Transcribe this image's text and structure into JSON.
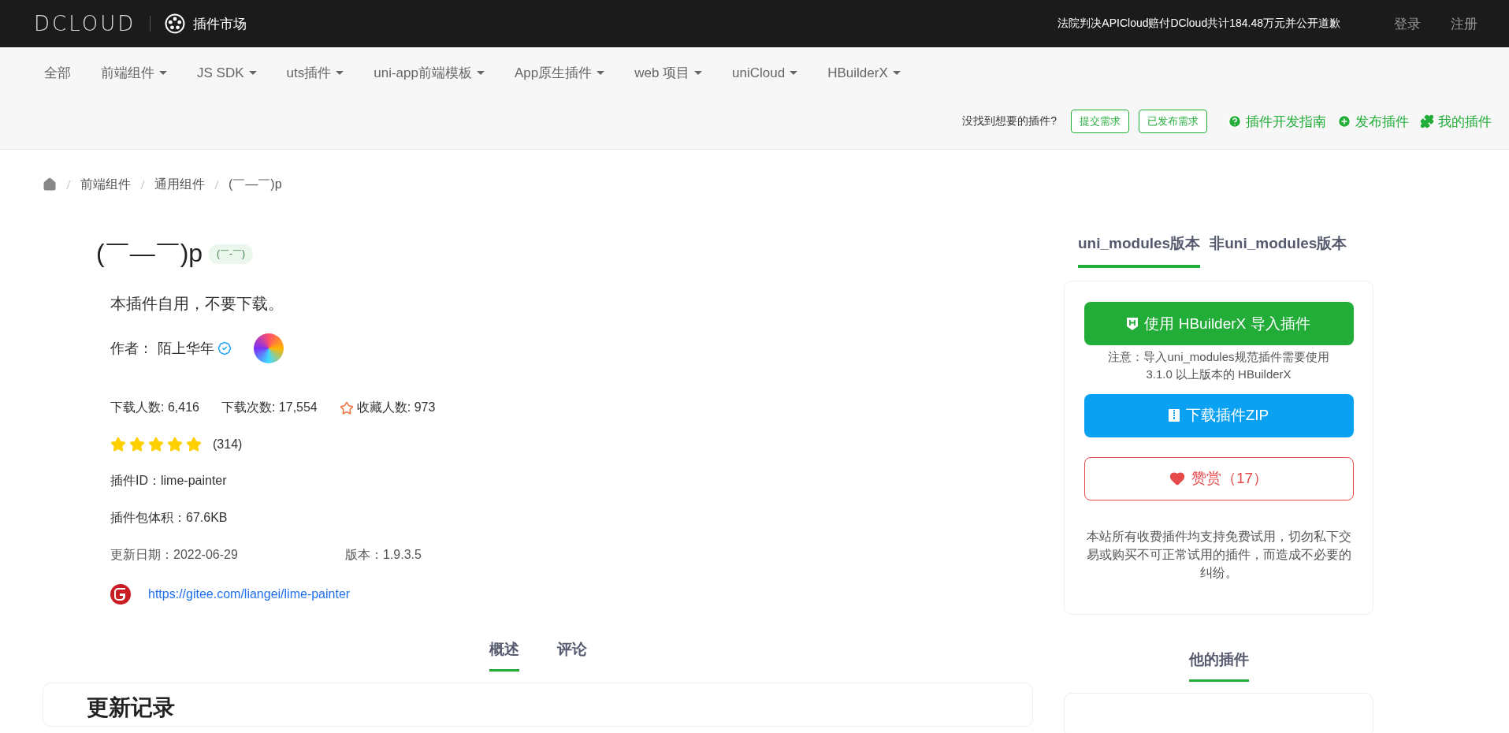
{
  "header": {
    "logo": "DCLOUD",
    "market": "插件市场",
    "notice": "法院判决APICloud赔付DCloud共计184.48万元并公开道歉",
    "links": [
      "登录",
      "注册"
    ]
  },
  "nav": {
    "items": [
      {
        "label": "全部",
        "dropdown": false
      },
      {
        "label": "前端组件",
        "dropdown": true
      },
      {
        "label": "JS SDK",
        "dropdown": true
      },
      {
        "label": "uts插件",
        "dropdown": true
      },
      {
        "label": "uni-app前端模板",
        "dropdown": true
      },
      {
        "label": "App原生插件",
        "dropdown": true
      },
      {
        "label": "web 项目",
        "dropdown": true
      },
      {
        "label": "uniCloud",
        "dropdown": true
      },
      {
        "label": "HBuilderX",
        "dropdown": true
      }
    ],
    "prompt": "没找到想要的插件?",
    "outline_buttons": [
      "提交需求",
      "已发布需求"
    ],
    "actions": [
      {
        "kind": "help",
        "label": "插件开发指南"
      },
      {
        "kind": "publish",
        "label": "发布插件"
      },
      {
        "kind": "puzzle",
        "label": "我的插件"
      }
    ]
  },
  "breadcrumb": [
    "前端组件",
    "通用组件",
    "(￣—￣)p"
  ],
  "plugin": {
    "title": "(￣—￣)p",
    "badge": "(￣-￣)",
    "description": "本插件自用，不要下载。",
    "author_label": "作者：",
    "author": "陌上华年",
    "verified": true,
    "stats": [
      {
        "kind": "plain",
        "text": "下载人数: 6,416"
      },
      {
        "kind": "plain",
        "text": "下载次数: 17,554"
      },
      {
        "kind": "favorite",
        "text": "收藏人数: 973"
      }
    ],
    "stars": 5,
    "rating_count": "(314)",
    "plugin_id": "插件ID：lime-painter",
    "size": "插件包体积：67.6KB",
    "updated": "更新日期：2022-06-29",
    "version": "版本：1.9.3.5",
    "repo_url": "https://gitee.com/liangei/lime-painter"
  },
  "version_tabs": [
    {
      "label": "uni_modules版本",
      "selected": true
    },
    {
      "label": "非uni_modules版本",
      "selected": false
    }
  ],
  "actions": {
    "import": "使用 HBuilderX 导入插件",
    "note": "注意：导入uni_modules规范插件需要使用3.1.0 以上版本的 HBuilderX",
    "download": "下载插件ZIP",
    "reward": "赞赏（17）",
    "disclaimer": "本站所有收费插件均支持免费试用，切勿私下交易或购买不可正常试用的插件，而造成不必要的纠纷。"
  },
  "content_tabs": [
    {
      "label": "概述",
      "selected": true
    },
    {
      "label": "评论",
      "selected": false
    }
  ],
  "side_tab": {
    "label": "他的插件",
    "selected": true
  },
  "section_title": "更新记录"
}
